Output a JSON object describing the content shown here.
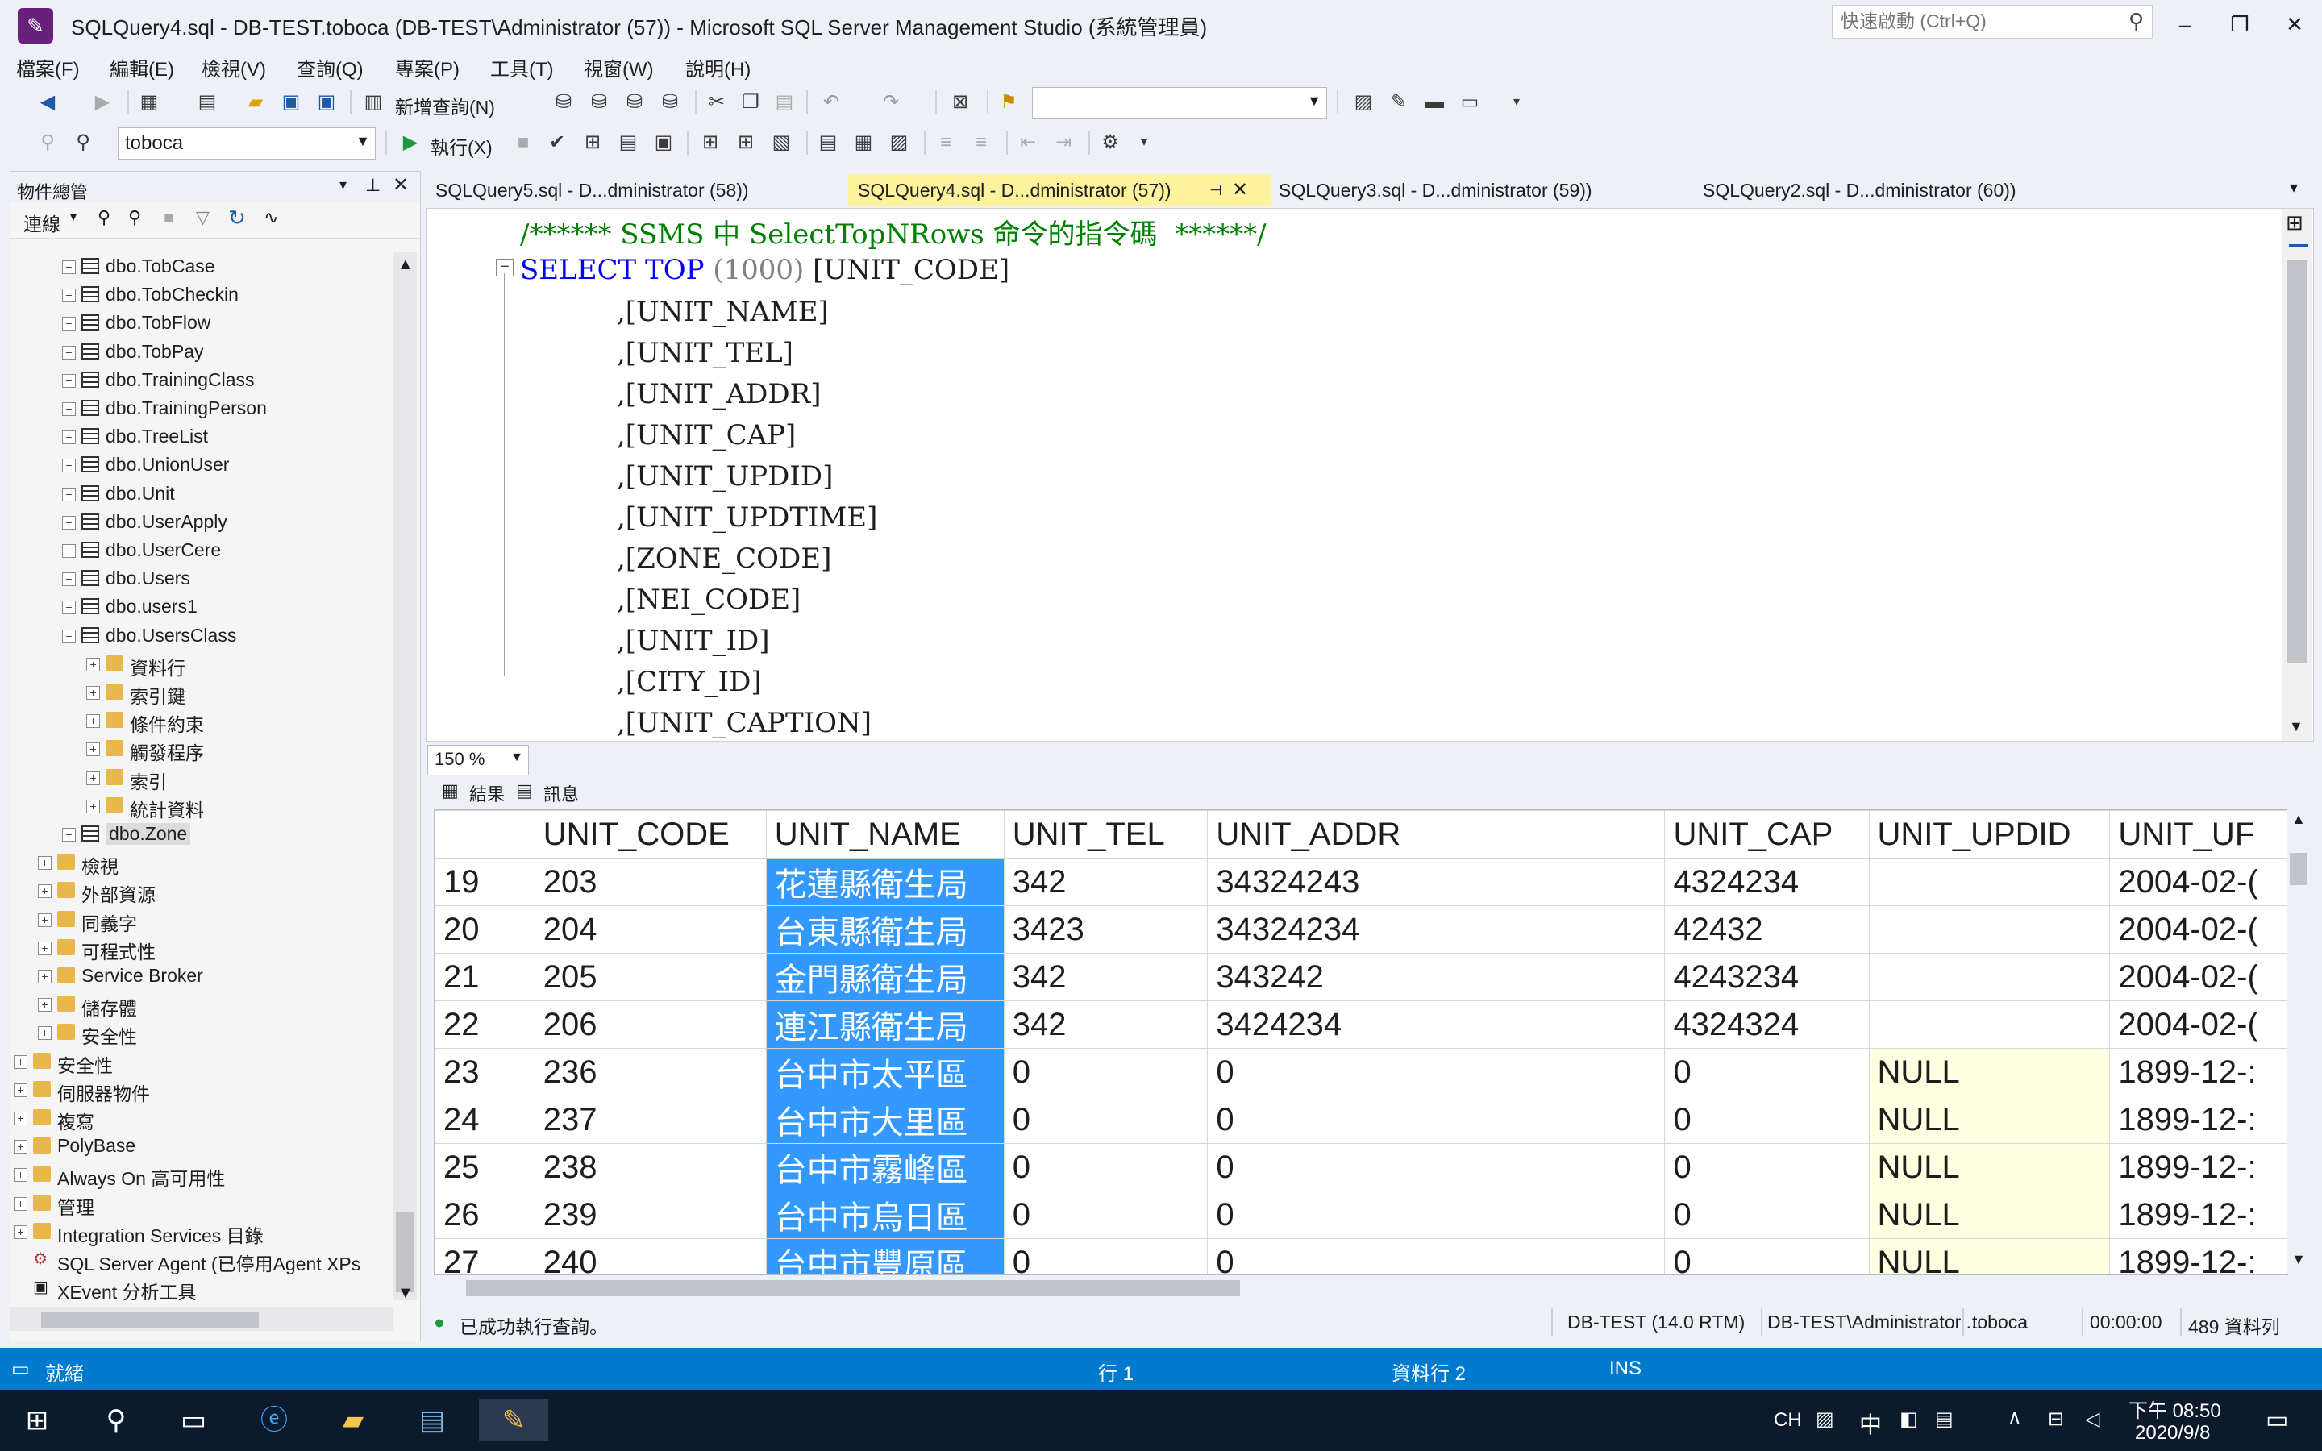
{
  "window": {
    "title": "SQLQuery4.sql - DB-TEST.toboca (DB-TEST\\Administrator (57)) - Microsoft SQL Server Management Studio (系統管理員)",
    "quick_launch_placeholder": "快速啟動 (Ctrl+Q)"
  },
  "menu": [
    "檔案(F)",
    "編輯(E)",
    "檢視(V)",
    "查詢(Q)",
    "專案(P)",
    "工具(T)",
    "視窗(W)",
    "說明(H)"
  ],
  "toolbar": {
    "new_query_label": "新增查詢(N)",
    "database_selector": "toboca",
    "execute_label": "執行(X)"
  },
  "object_explorer": {
    "title": "物件總管",
    "connect_label": "連線",
    "tree": [
      {
        "label": "dbo.TobCase",
        "type": "table"
      },
      {
        "label": "dbo.TobCheckin",
        "type": "table"
      },
      {
        "label": "dbo.TobFlow",
        "type": "table"
      },
      {
        "label": "dbo.TobPay",
        "type": "table"
      },
      {
        "label": "dbo.TrainingClass",
        "type": "table"
      },
      {
        "label": "dbo.TrainingPerson",
        "type": "table"
      },
      {
        "label": "dbo.TreeList",
        "type": "table"
      },
      {
        "label": "dbo.UnionUser",
        "type": "table"
      },
      {
        "label": "dbo.Unit",
        "type": "table"
      },
      {
        "label": "dbo.UserApply",
        "type": "table"
      },
      {
        "label": "dbo.UserCere",
        "type": "table"
      },
      {
        "label": "dbo.Users",
        "type": "table"
      },
      {
        "label": "dbo.users1",
        "type": "table"
      },
      {
        "label": "dbo.UsersClass",
        "type": "table"
      },
      {
        "label": "資料行",
        "type": "folder"
      },
      {
        "label": "索引鍵",
        "type": "folder"
      },
      {
        "label": "條件約束",
        "type": "folder"
      },
      {
        "label": "觸發程序",
        "type": "folder"
      },
      {
        "label": "索引",
        "type": "folder"
      },
      {
        "label": "統計資料",
        "type": "folder"
      },
      {
        "label": "dbo.Zone",
        "type": "table"
      },
      {
        "label": "檢視",
        "type": "folder"
      },
      {
        "label": "外部資源",
        "type": "folder"
      },
      {
        "label": "同義字",
        "type": "folder"
      },
      {
        "label": "可程式性",
        "type": "folder"
      },
      {
        "label": "Service Broker",
        "type": "folder"
      },
      {
        "label": "儲存體",
        "type": "folder"
      },
      {
        "label": "安全性",
        "type": "folder"
      },
      {
        "label": "安全性",
        "type": "folder"
      },
      {
        "label": "伺服器物件",
        "type": "folder"
      },
      {
        "label": "複寫",
        "type": "folder"
      },
      {
        "label": "PolyBase",
        "type": "folder"
      },
      {
        "label": "Always On 高可用性",
        "type": "folder"
      },
      {
        "label": "管理",
        "type": "folder"
      },
      {
        "label": "Integration Services 目錄",
        "type": "folder"
      },
      {
        "label": "SQL Server Agent (已停用Agent XPs",
        "type": "agent"
      },
      {
        "label": "XEvent 分析工具",
        "type": "xevent"
      }
    ]
  },
  "tabs": [
    {
      "label": "SQLQuery5.sql - D...dministrator (58))",
      "active": false
    },
    {
      "label": "SQLQuery4.sql - D...dministrator (57))",
      "active": true
    },
    {
      "label": "SQLQuery3.sql - D...dministrator (59))",
      "active": false
    },
    {
      "label": "SQLQuery2.sql - D...dministrator (60))",
      "active": false
    }
  ],
  "editor": {
    "comment": "/****** SSMS 中 SelectTopNRows 命令的指令碼  ******/",
    "select_kw": "SELECT",
    "top_kw": "TOP",
    "top_value": "(1000)",
    "first_column": "[UNIT_CODE]",
    "columns": [
      ",[UNIT_NAME]",
      ",[UNIT_TEL]",
      ",[UNIT_ADDR]",
      ",[UNIT_CAP]",
      ",[UNIT_UPDID]",
      ",[UNIT_UPDTIME]",
      ",[ZONE_CODE]",
      ",[NEI_CODE]",
      ",[UNIT_ID]",
      ",[CITY_ID]",
      ",[UNIT_CAPTION]"
    ],
    "zoom": "150 %"
  },
  "results": {
    "tab_results": "結果",
    "tab_messages": "訊息",
    "headers": [
      "UNIT_CODE",
      "UNIT_NAME",
      "UNIT_TEL",
      "UNIT_ADDR",
      "UNIT_CAP",
      "UNIT_UPDID",
      "UNIT_UF"
    ],
    "rows": [
      [
        "19",
        "203",
        "花蓮縣衛生局",
        "342",
        "34324243",
        "4324234",
        "",
        "2004-02-("
      ],
      [
        "20",
        "204",
        "台東縣衛生局",
        "3423",
        "34324234",
        "42432",
        "",
        "2004-02-("
      ],
      [
        "21",
        "205",
        "金門縣衛生局",
        "342",
        "343242",
        "4243234",
        "",
        "2004-02-("
      ],
      [
        "22",
        "206",
        "連江縣衛生局",
        "342",
        "3424234",
        "4324324",
        "",
        "2004-02-("
      ],
      [
        "23",
        "236",
        "台中市太平區",
        "0",
        "0",
        "0",
        "NULL",
        "1899-12-:"
      ],
      [
        "24",
        "237",
        "台中市大里區",
        "0",
        "0",
        "0",
        "NULL",
        "1899-12-:"
      ],
      [
        "25",
        "238",
        "台中市霧峰區",
        "0",
        "0",
        "0",
        "NULL",
        "1899-12-:"
      ],
      [
        "26",
        "239",
        "台中市烏日區",
        "0",
        "0",
        "0",
        "NULL",
        "1899-12-:"
      ],
      [
        "27",
        "240",
        "台中市豐原區",
        "0",
        "0",
        "0",
        "NULL",
        "1899-12-:"
      ]
    ]
  },
  "query_status": {
    "message": "已成功執行查詢。",
    "server": "DB-TEST (14.0 RTM)",
    "user": "DB-TEST\\Administrator ...",
    "database": "toboca",
    "elapsed": "00:00:00",
    "rows": "489 資料列"
  },
  "statusbar": {
    "ready": "就緒",
    "line": "行 1",
    "col": "資料行 2",
    "mode": "INS"
  },
  "taskbar": {
    "lang": "CH",
    "ime": "中",
    "time": "下午 08:50",
    "date": "2020/9/8"
  },
  "colors": {
    "accent": "#007acc",
    "active_tab": "#fff29d",
    "selected_column": "#3399ff",
    "null_cell": "#ffffe1",
    "keyword": "#0000ff",
    "comment": "#008000"
  }
}
